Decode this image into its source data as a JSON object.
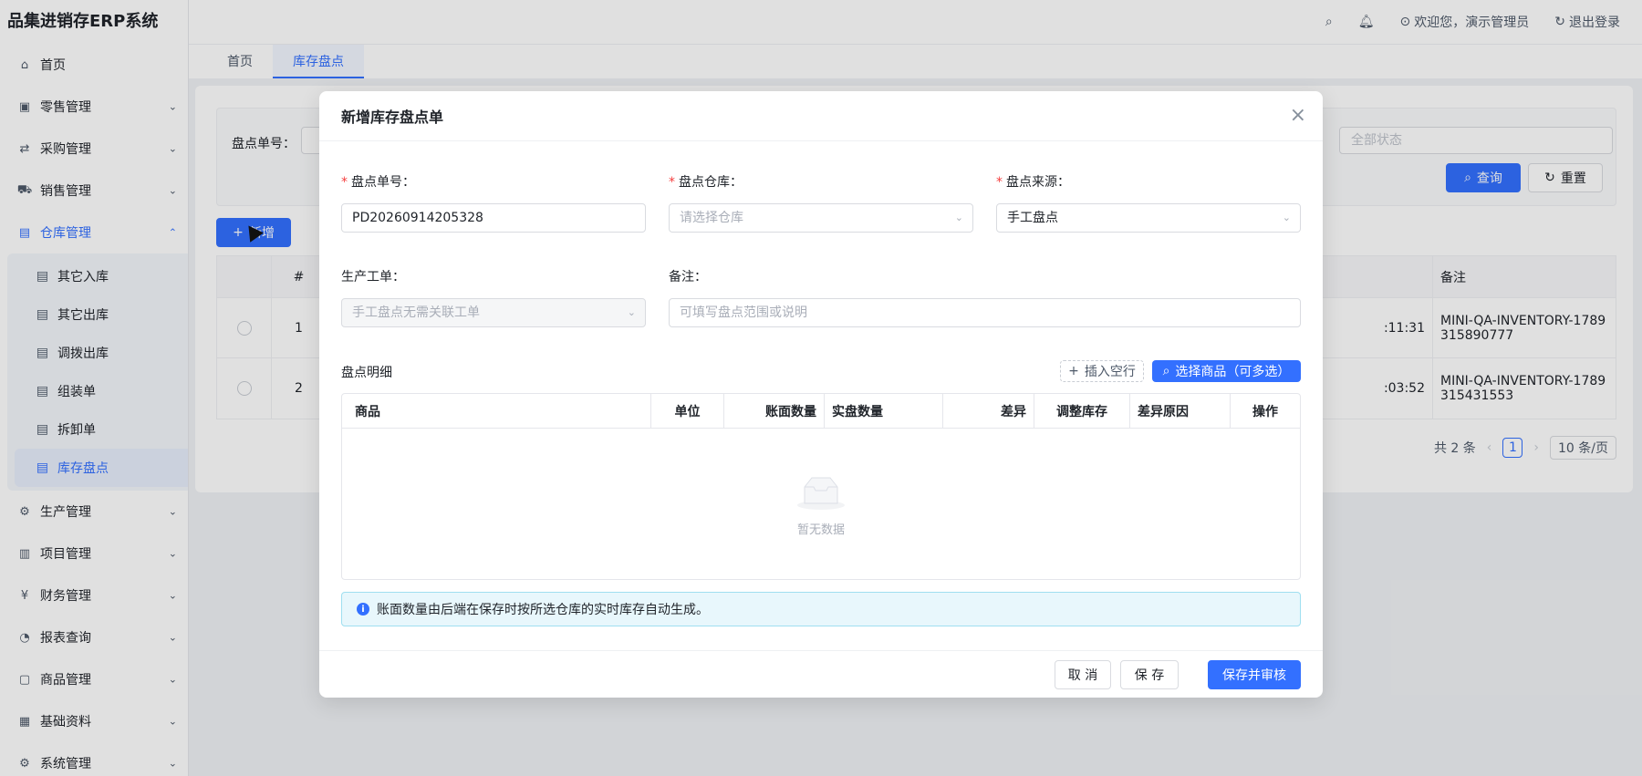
{
  "app": {
    "title": "品集进销存ERP系统"
  },
  "header": {
    "welcome": "欢迎您，演示管理员",
    "logout": "退出登录"
  },
  "sidebar": {
    "items": [
      {
        "label": "首页"
      },
      {
        "label": "零售管理"
      },
      {
        "label": "采购管理"
      },
      {
        "label": "销售管理"
      },
      {
        "label": "仓库管理"
      },
      {
        "label": "生产管理"
      },
      {
        "label": "项目管理"
      },
      {
        "label": "财务管理"
      },
      {
        "label": "报表查询"
      },
      {
        "label": "商品管理"
      },
      {
        "label": "基础资料"
      },
      {
        "label": "系统管理"
      }
    ],
    "warehouse_sub": [
      {
        "label": "其它入库"
      },
      {
        "label": "其它出库"
      },
      {
        "label": "调拨出库"
      },
      {
        "label": "组装单"
      },
      {
        "label": "拆卸单"
      },
      {
        "label": "库存盘点"
      }
    ]
  },
  "tabs": [
    {
      "label": "首页"
    },
    {
      "label": "库存盘点"
    }
  ],
  "page": {
    "filter_label": "盘点单号：",
    "status_placeholder": "全部状态",
    "query": "查询",
    "reset": "重置",
    "add": "新增",
    "columns": {
      "index": "#",
      "remark": "备注"
    },
    "rows": [
      {
        "index": "1",
        "time": ":11:31",
        "remark": "MINI-QA-INVENTORY-1789315890777"
      },
      {
        "index": "2",
        "time": ":03:52",
        "remark": "MINI-QA-INVENTORY-1789315431553"
      }
    ],
    "total": "共 2 条",
    "page": "1",
    "page_size": "10 条/页"
  },
  "modal": {
    "title": "新增库存盘点单",
    "order_no_label": "盘点单号：",
    "order_no_value": "PD20260914205328",
    "warehouse_label": "盘点仓库：",
    "warehouse_placeholder": "请选择仓库",
    "source_label": "盘点来源：",
    "source_value": "手工盘点",
    "work_order_label": "生产工单：",
    "work_order_value": "手工盘点无需关联工单",
    "remark_label": "备注：",
    "remark_placeholder": "可填写盘点范围或说明",
    "detail_title": "盘点明细",
    "insert_row": "插入空行",
    "select_goods": "选择商品（可多选）",
    "columns": [
      "商品",
      "单位",
      "账面数量",
      "实盘数量",
      "差异",
      "调整库存",
      "差异原因",
      "操作"
    ],
    "empty": "暂无数据",
    "info": "账面数量由后端在保存时按所选仓库的实时库存自动生成。",
    "cancel": "取 消",
    "save": "保 存",
    "save_audit": "保存并审核"
  }
}
